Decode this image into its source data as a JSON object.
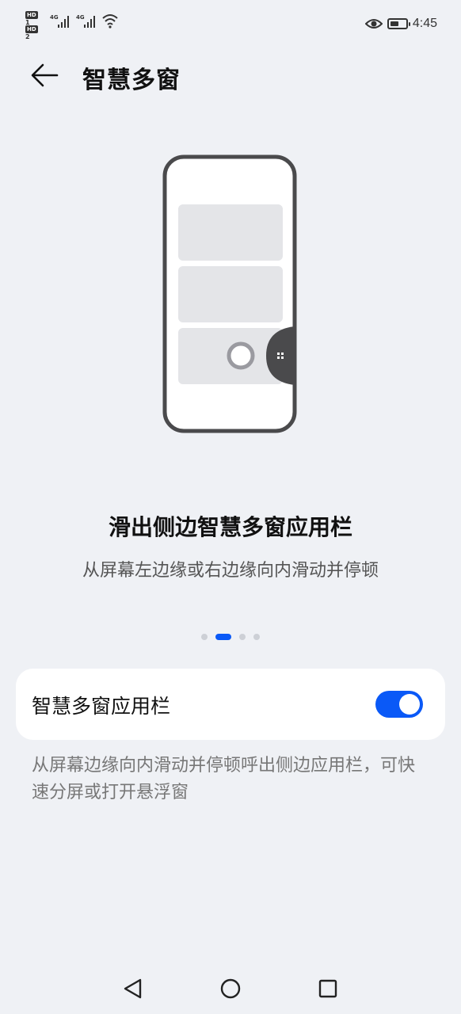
{
  "status_bar": {
    "sim1": "HD",
    "sim1_index": "1",
    "sim2": "HD",
    "sim2_index": "2",
    "net1": "4G",
    "net2": "4G",
    "time": "4:45",
    "battery_level": 0.55,
    "icons": [
      "signal-icon",
      "wifi-icon",
      "eye-comfort-icon",
      "battery-icon"
    ]
  },
  "header": {
    "title": "智慧多窗"
  },
  "intro": {
    "title": "滑出侧边智慧多窗应用栏",
    "description": "从屏幕左边缘或右边缘向内滑动并停顿"
  },
  "pager": {
    "count": 4,
    "active_index": 1
  },
  "setting": {
    "label": "智慧多窗应用栏",
    "enabled": true,
    "footnote": "从屏幕边缘向内滑动并停顿呼出侧边应用栏，可快速分屏或打开悬浮窗"
  },
  "colors": {
    "accent": "#0a59f7",
    "background": "#eff1f5"
  },
  "nav_bar": {
    "icons": [
      "back-triangle-icon",
      "home-circle-icon",
      "recents-square-icon"
    ]
  }
}
